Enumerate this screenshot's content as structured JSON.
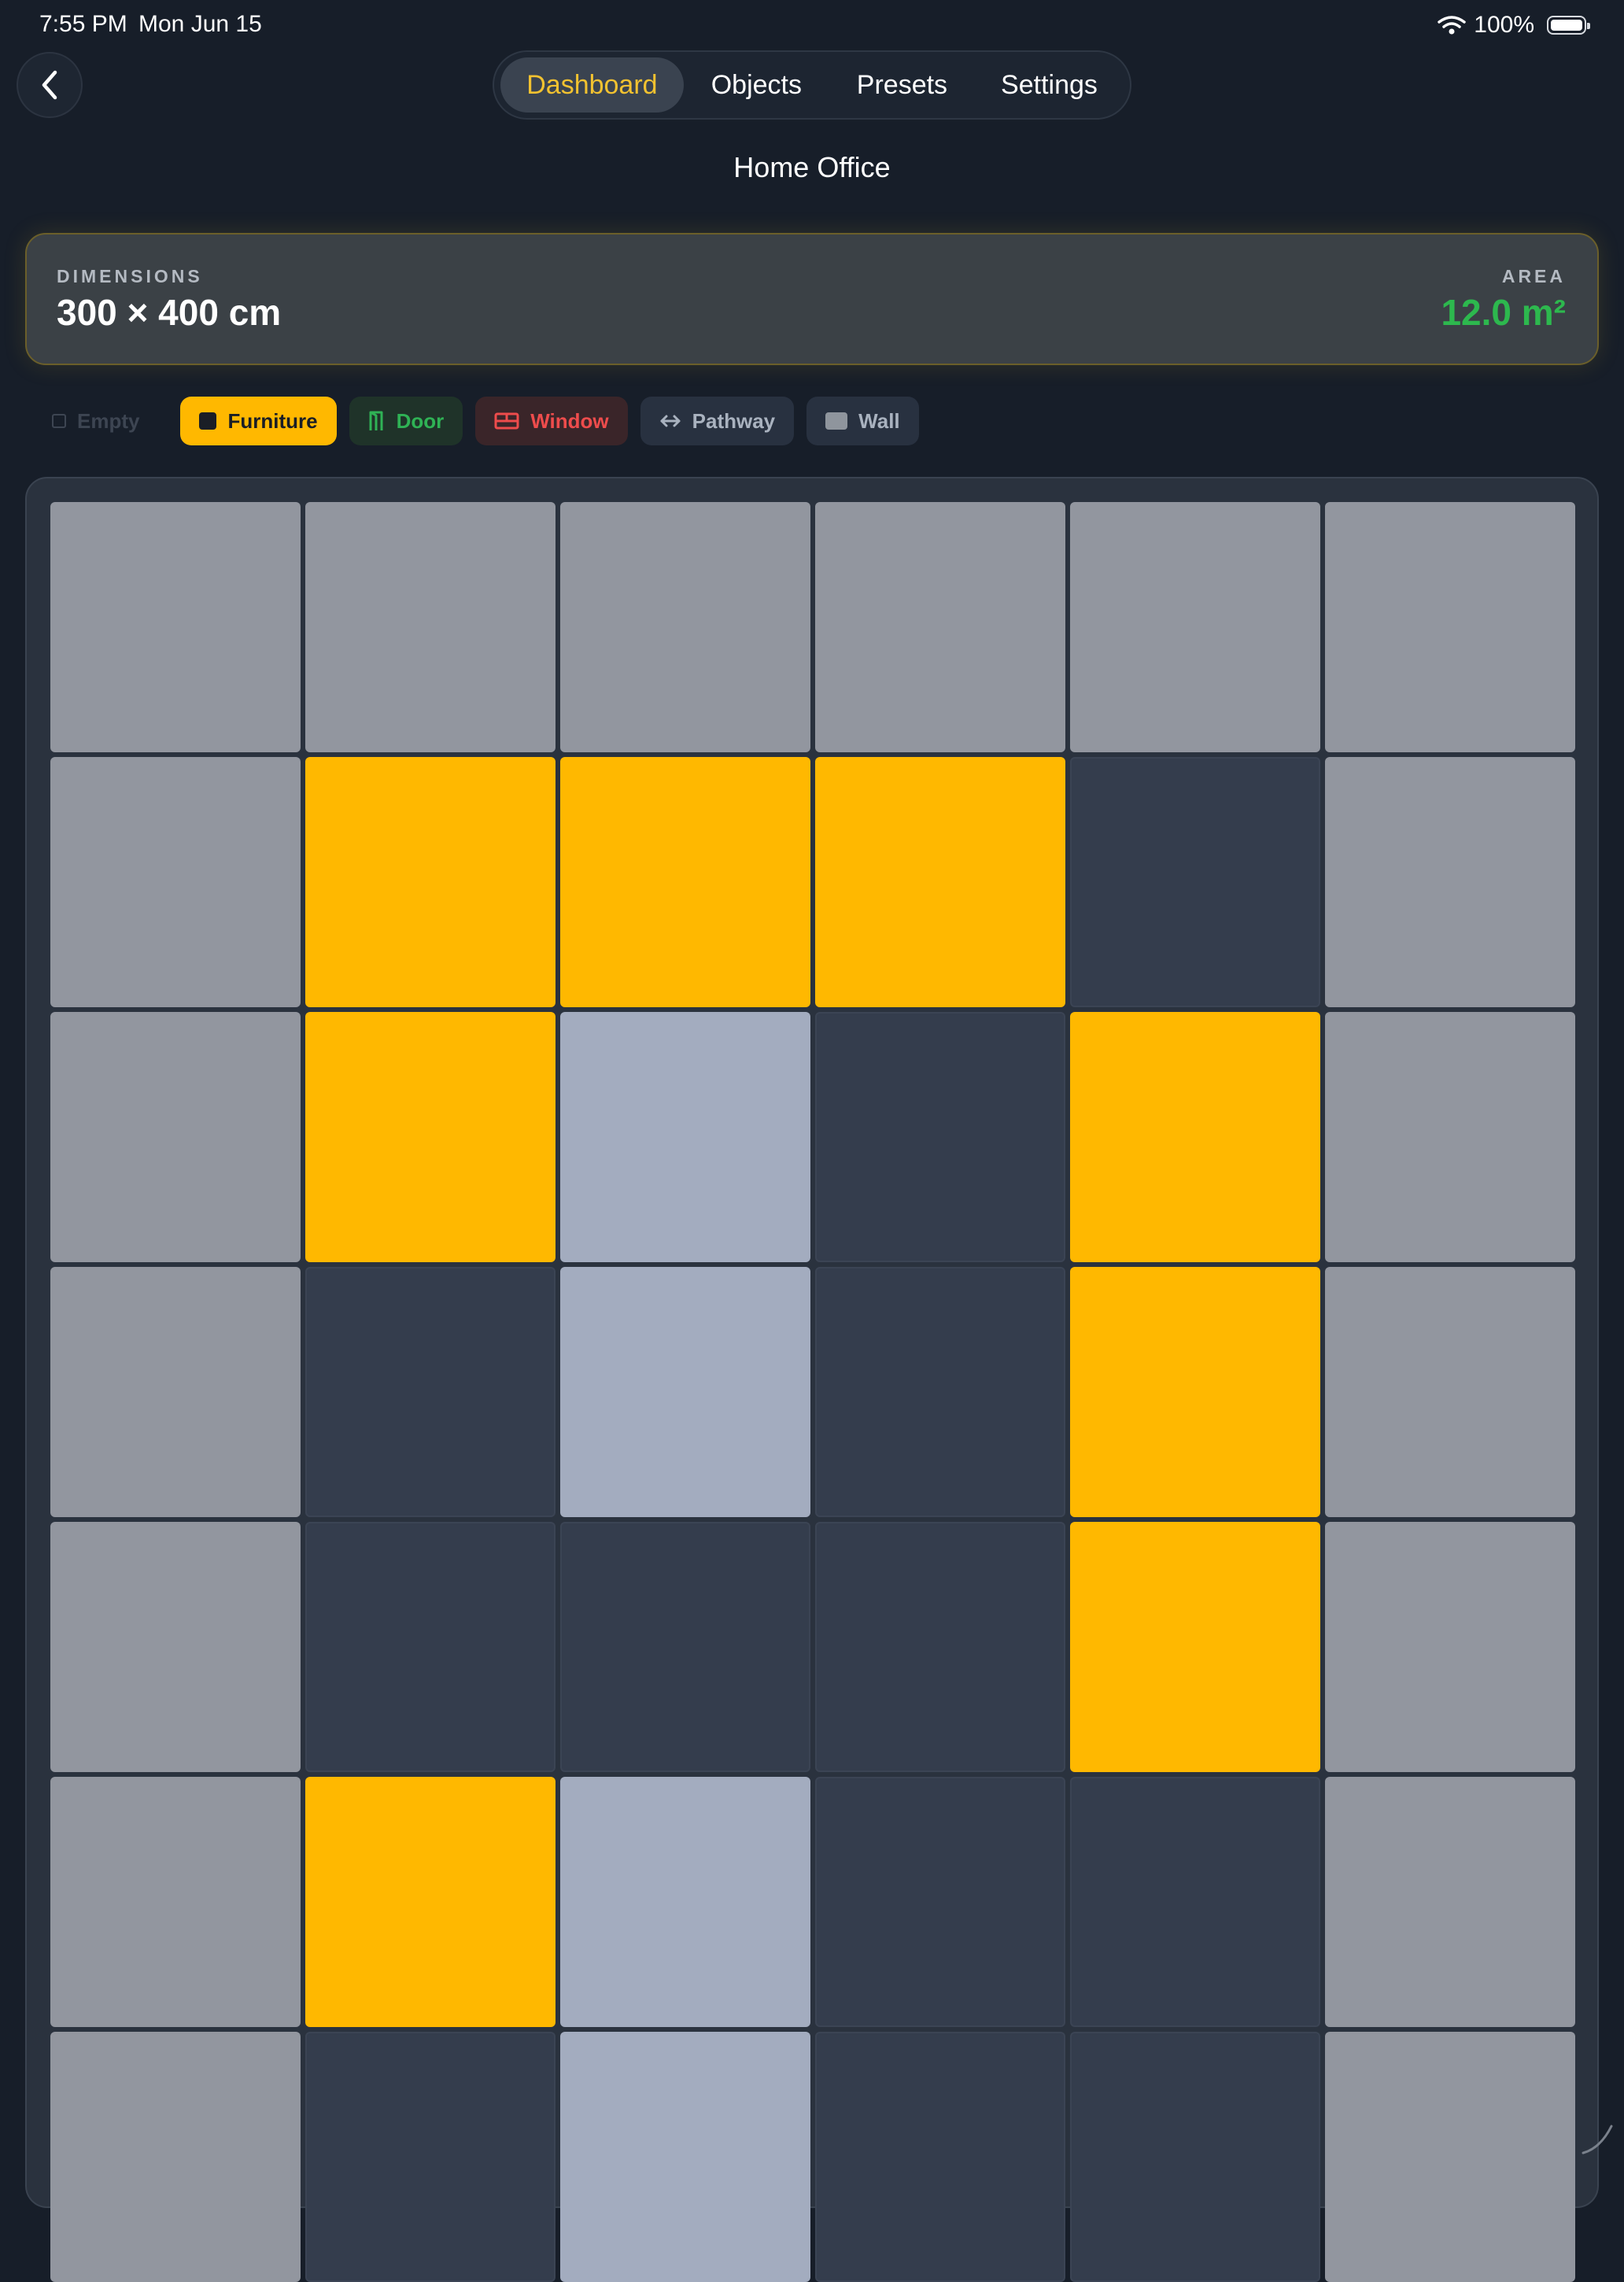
{
  "status_bar": {
    "time": "7:55 PM",
    "date": "Mon Jun 15",
    "battery": "100%"
  },
  "tabs": [
    {
      "label": "Dashboard",
      "active": true
    },
    {
      "label": "Objects",
      "active": false
    },
    {
      "label": "Presets",
      "active": false
    },
    {
      "label": "Settings",
      "active": false
    }
  ],
  "page_title": "Home Office",
  "dimensions": {
    "label": "DIMENSIONS",
    "value": "300 × 400 cm"
  },
  "area": {
    "label": "AREA",
    "value": "12.0 m²"
  },
  "legend": {
    "empty": "Empty",
    "furniture": "Furniture",
    "door": "Door",
    "window": "Window",
    "pathway": "Pathway",
    "wall": "Wall"
  },
  "colors": {
    "accent": "#f2c230",
    "furniture": "#ffb800",
    "door": "#2fb255",
    "window": "#ee4c4c",
    "pathway": "#a3acbf",
    "wall": "#92969f",
    "empty": "#343d4d",
    "area_value": "#2db84e"
  },
  "icons": {
    "back": "chevron-left-icon",
    "wifi": "wifi-icon",
    "battery": "battery-icon",
    "door": "door-icon",
    "window": "window-icon",
    "pathway": "arrows-horizontal-icon",
    "resize": "resize-handle-icon"
  },
  "grid": {
    "columns": 6,
    "rows": [
      [
        "wall",
        "wall",
        "wall",
        "wall",
        "wall",
        "wall"
      ],
      [
        "wall",
        "furniture",
        "furniture",
        "furniture",
        "empty",
        "wall"
      ],
      [
        "wall",
        "furniture",
        "pathway",
        "empty",
        "furniture",
        "wall"
      ],
      [
        "wall",
        "empty",
        "pathway",
        "empty",
        "furniture",
        "wall"
      ],
      [
        "wall",
        "empty",
        "empty",
        "empty",
        "furniture",
        "wall"
      ],
      [
        "wall",
        "furniture",
        "pathway",
        "empty",
        "empty",
        "wall"
      ],
      [
        "wall",
        "empty",
        "pathway",
        "empty",
        "empty",
        "wall"
      ]
    ]
  }
}
